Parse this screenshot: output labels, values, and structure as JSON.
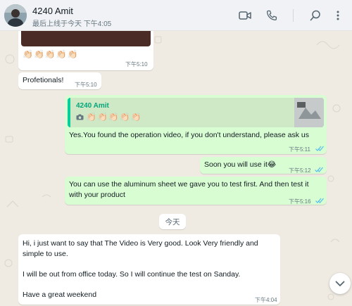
{
  "header": {
    "contact_name": "4240 Amit",
    "last_seen": "最后上线于今天 下午4:05",
    "icons": [
      "video-call-icon",
      "voice-call-icon",
      "search-icon",
      "menu-icon"
    ]
  },
  "messages": {
    "m1": {
      "emoji": "👏🏻👏🏻👏🏻👏🏻👏🏻",
      "time": "下午5:10",
      "direction": "incoming"
    },
    "m2": {
      "text": "Profetionals!",
      "time": "下午5:10",
      "direction": "incoming"
    },
    "m3": {
      "quote_author": "4240 Amit",
      "quote_emoji": "👏🏻👏🏻👏🏻👏🏻👏🏻",
      "quote_icon": "camera-icon",
      "text": "Yes.You found the operation video, if you don't understand, please ask us",
      "time": "下午5:11",
      "direction": "outgoing",
      "status": "read"
    },
    "m4": {
      "text": "Soon you will use it😂",
      "time": "下午5:12",
      "direction": "outgoing",
      "status": "read"
    },
    "m5": {
      "text_line1": "You can use the aluminum sheet we gave you to test first. And then test it",
      "text_line2": "with your product",
      "time": "下午5:16",
      "direction": "outgoing",
      "status": "read"
    },
    "date_divider": "今天",
    "m6": {
      "line1": "Hi, i just want to say that The Video is Very good. Look Very friendly and",
      "line2": "simple to use.",
      "line3": "I will be out from office today. So I will continue the test on Sanday.",
      "line4": "Have a great weekend",
      "time": "下午4:04",
      "direction": "incoming"
    }
  },
  "colors": {
    "outgoing_bubble": "#d9fdd3",
    "incoming_bubble": "#ffffff",
    "read_ticks": "#53bdeb",
    "quote_accent": "#06cf9c",
    "chat_background": "#efeae2"
  }
}
